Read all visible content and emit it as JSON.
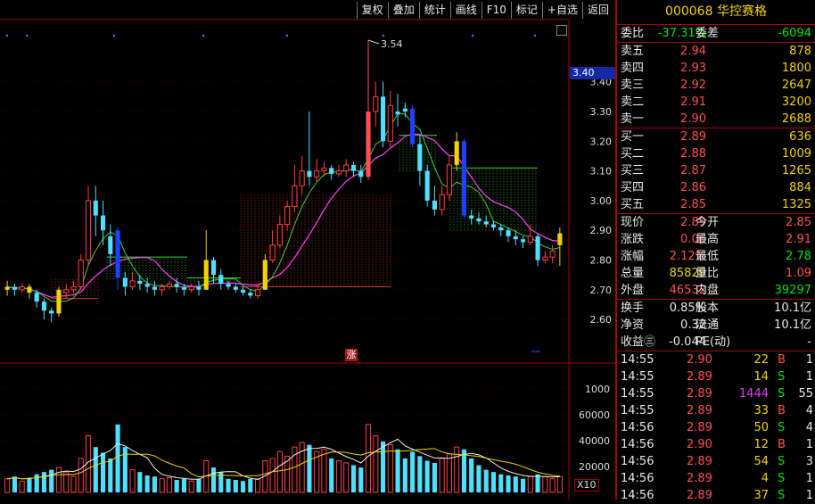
{
  "toolbar": [
    "复权",
    "叠加",
    "统计",
    "画线",
    "F10",
    "标记",
    "+自选",
    "返回"
  ],
  "stock": {
    "code": "000068",
    "name": "华控赛格"
  },
  "chart_data": {
    "type": "candlestick",
    "y_ticks": [
      "3.40",
      "3.30",
      "3.20",
      "3.10",
      "3.00",
      "2.90",
      "2.80",
      "2.70",
      "2.60"
    ],
    "high_label": "3.54",
    "price_tag": "3.40",
    "badge": "涨",
    "vol_ticks": [
      "1000",
      "60000",
      "40000",
      "20000"
    ],
    "vol_scale": "X10",
    "candles": [
      {
        "o": 2.7,
        "c": 2.71,
        "h": 2.73,
        "l": 2.68
      },
      {
        "o": 2.71,
        "c": 2.7,
        "h": 2.72,
        "l": 2.68
      },
      {
        "o": 2.7,
        "c": 2.71,
        "h": 2.72,
        "l": 2.69
      },
      {
        "o": 2.71,
        "c": 2.69,
        "h": 2.72,
        "l": 2.67
      },
      {
        "o": 2.69,
        "c": 2.66,
        "h": 2.7,
        "l": 2.64
      },
      {
        "o": 2.66,
        "c": 2.63,
        "h": 2.67,
        "l": 2.6
      },
      {
        "o": 2.63,
        "c": 2.62,
        "h": 2.64,
        "l": 2.59
      },
      {
        "o": 2.62,
        "c": 2.7,
        "h": 2.71,
        "l": 2.61
      },
      {
        "o": 2.69,
        "c": 2.7,
        "h": 2.72,
        "l": 2.67
      },
      {
        "o": 2.7,
        "c": 2.71,
        "h": 2.73,
        "l": 2.69
      },
      {
        "o": 2.71,
        "c": 2.8,
        "h": 2.82,
        "l": 2.7
      },
      {
        "o": 2.8,
        "c": 3.0,
        "h": 3.05,
        "l": 2.78
      },
      {
        "o": 3.0,
        "c": 2.95,
        "h": 3.05,
        "l": 2.88
      },
      {
        "o": 2.95,
        "c": 2.9,
        "h": 3.0,
        "l": 2.85
      },
      {
        "o": 2.88,
        "c": 2.82,
        "h": 2.92,
        "l": 2.78
      },
      {
        "o": 2.9,
        "c": 2.74,
        "h": 2.91,
        "l": 2.7
      },
      {
        "o": 2.74,
        "c": 2.71,
        "h": 2.76,
        "l": 2.68
      },
      {
        "o": 2.71,
        "c": 2.73,
        "h": 2.76,
        "l": 2.7
      },
      {
        "o": 2.73,
        "c": 2.72,
        "h": 2.75,
        "l": 2.7
      },
      {
        "o": 2.72,
        "c": 2.71,
        "h": 2.74,
        "l": 2.69
      },
      {
        "o": 2.71,
        "c": 2.7,
        "h": 2.73,
        "l": 2.68
      },
      {
        "o": 2.7,
        "c": 2.71,
        "h": 2.72,
        "l": 2.68
      },
      {
        "o": 2.71,
        "c": 2.72,
        "h": 2.73,
        "l": 2.7
      },
      {
        "o": 2.72,
        "c": 2.71,
        "h": 2.74,
        "l": 2.69
      },
      {
        "o": 2.71,
        "c": 2.7,
        "h": 2.72,
        "l": 2.68
      },
      {
        "o": 2.7,
        "c": 2.71,
        "h": 2.72,
        "l": 2.69
      },
      {
        "o": 2.71,
        "c": 2.7,
        "h": 2.73,
        "l": 2.68
      },
      {
        "o": 2.7,
        "c": 2.8,
        "h": 2.9,
        "l": 2.7
      },
      {
        "o": 2.8,
        "c": 2.75,
        "h": 2.81,
        "l": 2.72
      },
      {
        "o": 2.75,
        "c": 2.72,
        "h": 2.77,
        "l": 2.7
      },
      {
        "o": 2.72,
        "c": 2.71,
        "h": 2.73,
        "l": 2.7
      },
      {
        "o": 2.71,
        "c": 2.7,
        "h": 2.72,
        "l": 2.69
      },
      {
        "o": 2.7,
        "c": 2.69,
        "h": 2.71,
        "l": 2.68
      },
      {
        "o": 2.69,
        "c": 2.68,
        "h": 2.7,
        "l": 2.67
      },
      {
        "o": 2.68,
        "c": 2.7,
        "h": 2.72,
        "l": 2.67
      },
      {
        "o": 2.7,
        "c": 2.8,
        "h": 2.82,
        "l": 2.7
      },
      {
        "o": 2.8,
        "c": 2.85,
        "h": 2.9,
        "l": 2.79
      },
      {
        "o": 2.85,
        "c": 2.92,
        "h": 2.95,
        "l": 2.84
      },
      {
        "o": 2.92,
        "c": 2.98,
        "h": 3.0,
        "l": 2.9
      },
      {
        "o": 2.98,
        "c": 3.05,
        "h": 3.12,
        "l": 2.96
      },
      {
        "o": 3.05,
        "c": 3.1,
        "h": 3.15,
        "l": 3.02
      },
      {
        "o": 3.1,
        "c": 3.08,
        "h": 3.3,
        "l": 3.05
      },
      {
        "o": 3.08,
        "c": 3.1,
        "h": 3.14,
        "l": 3.06
      },
      {
        "o": 3.1,
        "c": 3.11,
        "h": 3.13,
        "l": 3.08
      },
      {
        "o": 3.11,
        "c": 3.09,
        "h": 3.12,
        "l": 3.07
      },
      {
        "o": 3.09,
        "c": 3.1,
        "h": 3.12,
        "l": 3.08
      },
      {
        "o": 3.1,
        "c": 3.12,
        "h": 3.14,
        "l": 3.08
      },
      {
        "o": 3.12,
        "c": 3.1,
        "h": 3.13,
        "l": 3.08
      },
      {
        "o": 3.1,
        "c": 3.08,
        "h": 3.12,
        "l": 3.06
      },
      {
        "o": 3.08,
        "c": 3.3,
        "h": 3.54,
        "l": 3.07
      },
      {
        "o": 3.3,
        "c": 3.35,
        "h": 3.4,
        "l": 3.25
      },
      {
        "o": 3.35,
        "c": 3.2,
        "h": 3.4,
        "l": 3.18
      },
      {
        "o": 3.2,
        "c": 3.32,
        "h": 3.37,
        "l": 3.18
      },
      {
        "o": 3.3,
        "c": 3.29,
        "h": 3.36,
        "l": 3.25
      },
      {
        "o": 3.31,
        "c": 3.3,
        "h": 3.33,
        "l": 3.28
      },
      {
        "o": 3.31,
        "c": 3.19,
        "h": 3.32,
        "l": 3.18
      },
      {
        "o": 3.19,
        "c": 3.1,
        "h": 3.22,
        "l": 3.05
      },
      {
        "o": 3.1,
        "c": 3.0,
        "h": 3.12,
        "l": 2.98
      },
      {
        "o": 3.0,
        "c": 2.97,
        "h": 3.05,
        "l": 2.95
      },
      {
        "o": 2.97,
        "c": 3.02,
        "h": 3.05,
        "l": 2.95
      },
      {
        "o": 3.02,
        "c": 3.12,
        "h": 3.15,
        "l": 3.0
      },
      {
        "o": 3.12,
        "c": 3.2,
        "h": 3.23,
        "l": 3.1
      },
      {
        "o": 3.2,
        "c": 2.95,
        "h": 3.21,
        "l": 2.94
      },
      {
        "o": 2.95,
        "c": 2.94,
        "h": 2.97,
        "l": 2.92
      },
      {
        "o": 2.94,
        "c": 2.93,
        "h": 2.96,
        "l": 2.92
      },
      {
        "o": 2.93,
        "c": 2.92,
        "h": 2.95,
        "l": 2.91
      },
      {
        "o": 2.92,
        "c": 2.91,
        "h": 2.93,
        "l": 2.9
      },
      {
        "o": 2.91,
        "c": 2.9,
        "h": 2.92,
        "l": 2.88
      },
      {
        "o": 2.9,
        "c": 2.88,
        "h": 2.91,
        "l": 2.86
      },
      {
        "o": 2.88,
        "c": 2.87,
        "h": 2.9,
        "l": 2.85
      },
      {
        "o": 2.87,
        "c": 2.86,
        "h": 2.88,
        "l": 2.84
      },
      {
        "o": 2.86,
        "c": 2.88,
        "h": 2.92,
        "l": 2.85
      },
      {
        "o": 2.88,
        "c": 2.8,
        "h": 2.89,
        "l": 2.78
      },
      {
        "o": 2.8,
        "c": 2.81,
        "h": 2.83,
        "l": 2.79
      },
      {
        "o": 2.81,
        "c": 2.83,
        "h": 2.85,
        "l": 2.79
      },
      {
        "o": 2.85,
        "c": 2.89,
        "h": 2.91,
        "l": 2.78
      }
    ],
    "volumes": [
      12,
      14,
      10,
      13,
      16,
      18,
      20,
      22,
      18,
      14,
      30,
      50,
      40,
      35,
      30,
      60,
      40,
      20,
      18,
      15,
      14,
      12,
      13,
      11,
      12,
      10,
      12,
      28,
      22,
      18,
      12,
      11,
      10,
      12,
      12,
      28,
      30,
      36,
      32,
      40,
      44,
      42,
      36,
      38,
      30,
      28,
      26,
      24,
      22,
      60,
      50,
      45,
      42,
      38,
      30,
      36,
      32,
      28,
      26,
      30,
      34,
      40,
      38,
      30,
      24,
      20,
      18,
      16,
      15,
      14,
      12,
      14,
      16,
      14,
      12,
      14
    ]
  },
  "quote": {
    "weibi": {
      "label": "委比",
      "value": "-37.31%",
      "label2": "委差",
      "value2": "-6094"
    },
    "sell": [
      {
        "label": "卖五",
        "price": "2.94",
        "vol": "878"
      },
      {
        "label": "卖四",
        "price": "2.93",
        "vol": "1800"
      },
      {
        "label": "卖三",
        "price": "2.92",
        "vol": "2647"
      },
      {
        "label": "卖二",
        "price": "2.91",
        "vol": "3200"
      },
      {
        "label": "卖一",
        "price": "2.90",
        "vol": "2688"
      }
    ],
    "buy": [
      {
        "label": "买一",
        "price": "2.89",
        "vol": "636"
      },
      {
        "label": "买二",
        "price": "2.88",
        "vol": "1009"
      },
      {
        "label": "买三",
        "price": "2.87",
        "vol": "1265"
      },
      {
        "label": "买四",
        "price": "2.86",
        "vol": "884"
      },
      {
        "label": "买五",
        "price": "2.85",
        "vol": "1325"
      }
    ],
    "stats": [
      {
        "l1": "现价",
        "v1": "2.89",
        "c1": "red",
        "l2": "今开",
        "v2": "2.85",
        "c2": "red"
      },
      {
        "l1": "涨跌",
        "v1": "0.06",
        "c1": "red",
        "l2": "最高",
        "v2": "2.91",
        "c2": "red"
      },
      {
        "l1": "涨幅",
        "v1": "2.12%",
        "c1": "red",
        "l2": "最低",
        "v2": "2.78",
        "c2": "green"
      },
      {
        "l1": "总量",
        "v1": "85829",
        "c1": "yellow",
        "l2": "量比",
        "v2": "1.09",
        "c2": "red"
      },
      {
        "l1": "外盘",
        "v1": "46532",
        "c1": "red",
        "l2": "内盘",
        "v2": "39297",
        "c2": "green"
      }
    ],
    "stats2": [
      {
        "l1": "换手",
        "v1": "0.85%",
        "l2": "股本",
        "v2": "10.1亿"
      },
      {
        "l1": "净资",
        "v1": "0.32",
        "l2": "流通",
        "v2": "10.1亿"
      },
      {
        "l1": "收益㊂",
        "v1": "-0.044",
        "l2": "PE(动)",
        "v2": "-"
      }
    ],
    "ticks": [
      {
        "time": "14:55",
        "price": "2.90",
        "vol": "22",
        "side": "B",
        "n": "1",
        "pc": "red",
        "vc": "yellow",
        "sc": "red"
      },
      {
        "time": "14:55",
        "price": "2.89",
        "vol": "14",
        "side": "S",
        "n": "1",
        "pc": "red",
        "vc": "yellow",
        "sc": "green"
      },
      {
        "time": "14:55",
        "price": "2.89",
        "vol": "1444",
        "side": "S",
        "n": "55",
        "pc": "red",
        "vc": "magenta",
        "sc": "green"
      },
      {
        "time": "14:55",
        "price": "2.89",
        "vol": "33",
        "side": "B",
        "n": "4",
        "pc": "red",
        "vc": "yellow",
        "sc": "red"
      },
      {
        "time": "14:56",
        "price": "2.89",
        "vol": "50",
        "side": "S",
        "n": "4",
        "pc": "red",
        "vc": "yellow",
        "sc": "green"
      },
      {
        "time": "14:56",
        "price": "2.90",
        "vol": "12",
        "side": "B",
        "n": "1",
        "pc": "red",
        "vc": "yellow",
        "sc": "red"
      },
      {
        "time": "14:56",
        "price": "2.89",
        "vol": "54",
        "side": "S",
        "n": "3",
        "pc": "red",
        "vc": "yellow",
        "sc": "green"
      },
      {
        "time": "14:56",
        "price": "2.89",
        "vol": "4",
        "side": "S",
        "n": "1",
        "pc": "red",
        "vc": "yellow",
        "sc": "green"
      },
      {
        "time": "14:56",
        "price": "2.89",
        "vol": "37",
        "side": "S",
        "n": "1",
        "pc": "red",
        "vc": "yellow",
        "sc": "green"
      }
    ]
  }
}
